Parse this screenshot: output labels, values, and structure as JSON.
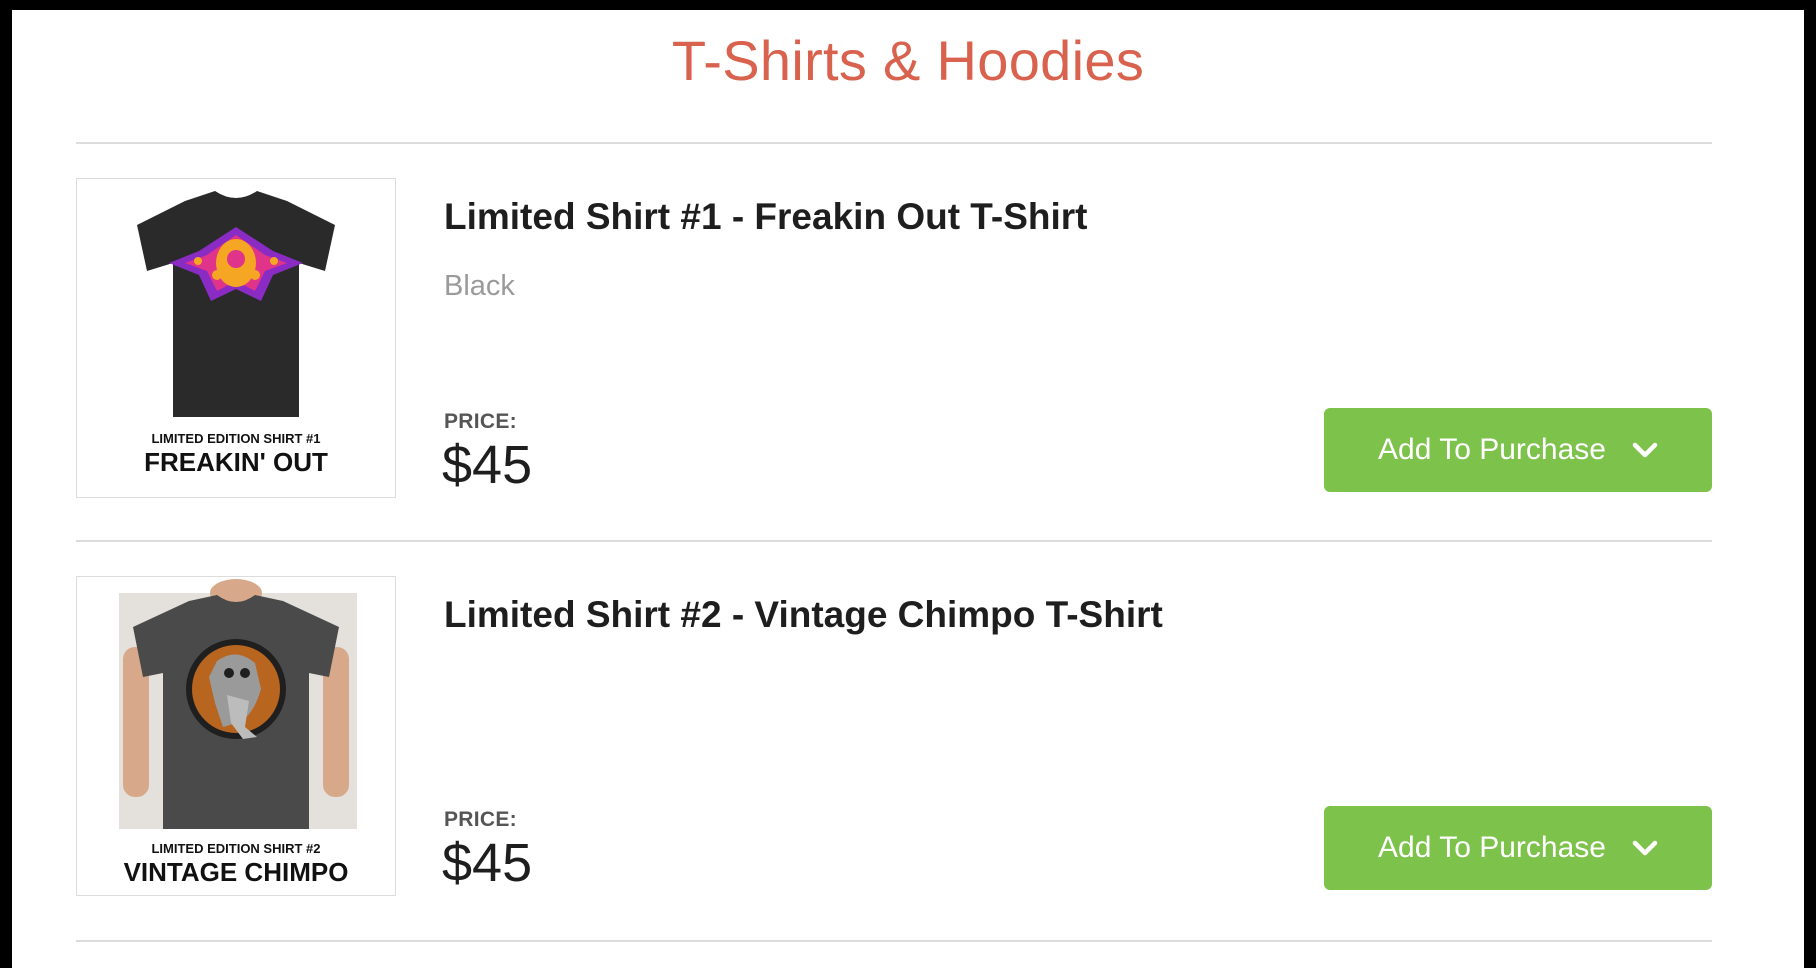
{
  "section": {
    "title": "T-Shirts & Hoodies"
  },
  "products": [
    {
      "name": "Limited Shirt #1 - Freakin Out T-Shirt",
      "variant": "Black",
      "price_label": "PRICE:",
      "price": "$45",
      "button_label": "Add To Purchase",
      "button_icon": "chevron-down-icon",
      "image": {
        "caption_small": "LIMITED EDITION SHIRT #1",
        "caption_big": "FREAKIN' OUT",
        "shirt_color": "#2a2a2a"
      }
    },
    {
      "name": "Limited Shirt #2 - Vintage Chimpo T-Shirt",
      "variant": "",
      "price_label": "PRICE:",
      "price": "$45",
      "button_label": "Add To Purchase",
      "button_icon": "chevron-down-icon",
      "image": {
        "caption_small": "LIMITED EDITION SHIRT #2",
        "caption_big": "VINTAGE CHIMPO",
        "shirt_color": "#4a4a4a"
      }
    }
  ],
  "colors": {
    "title": "#d9624e",
    "button": "#7dc24b",
    "divider": "#dcdcdc"
  }
}
